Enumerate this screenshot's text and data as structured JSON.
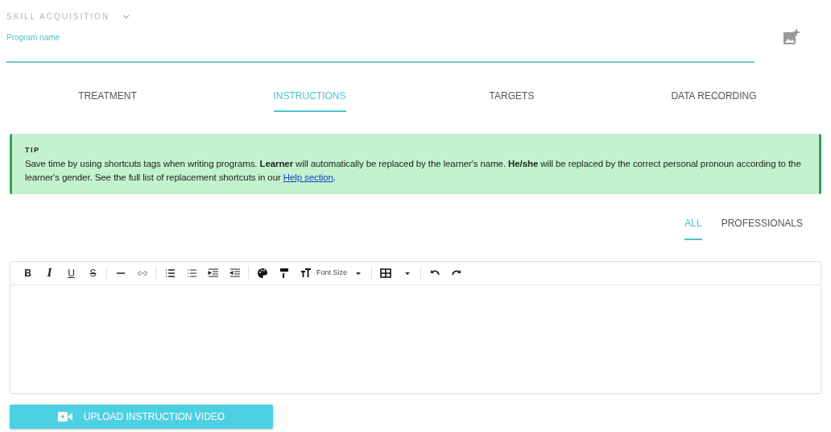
{
  "header": {
    "title": "SKILL ACQUISITION"
  },
  "program_name": {
    "label": "Program name"
  },
  "tabs": [
    {
      "label": "TREATMENT",
      "selected": false
    },
    {
      "label": "INSTRUCTIONS",
      "selected": true
    },
    {
      "label": "TARGETS",
      "selected": false
    },
    {
      "label": "DATA RECORDING",
      "selected": false
    }
  ],
  "tip": {
    "title": "TIP",
    "text": "Save time by using shortcuts tags when writing programs. **Learner** will automatically be replaced by the learner's name. **He/she** will be replaced by the correct personal pronoun according to the learner's gender. See the full list of replacement shortcuts in our ",
    "link": "Help section",
    "after": "."
  },
  "filter_tabs": [
    {
      "label": "ALL",
      "selected": true
    },
    {
      "label": "PROFESSIONALS",
      "selected": false
    }
  ],
  "toolbar": {
    "bold": "B",
    "italic": "I",
    "underline": "U",
    "strike": "S",
    "font_size": "Font Size"
  },
  "upload_button": {
    "label": "UPLOAD INSTRUCTION VIDEO"
  }
}
